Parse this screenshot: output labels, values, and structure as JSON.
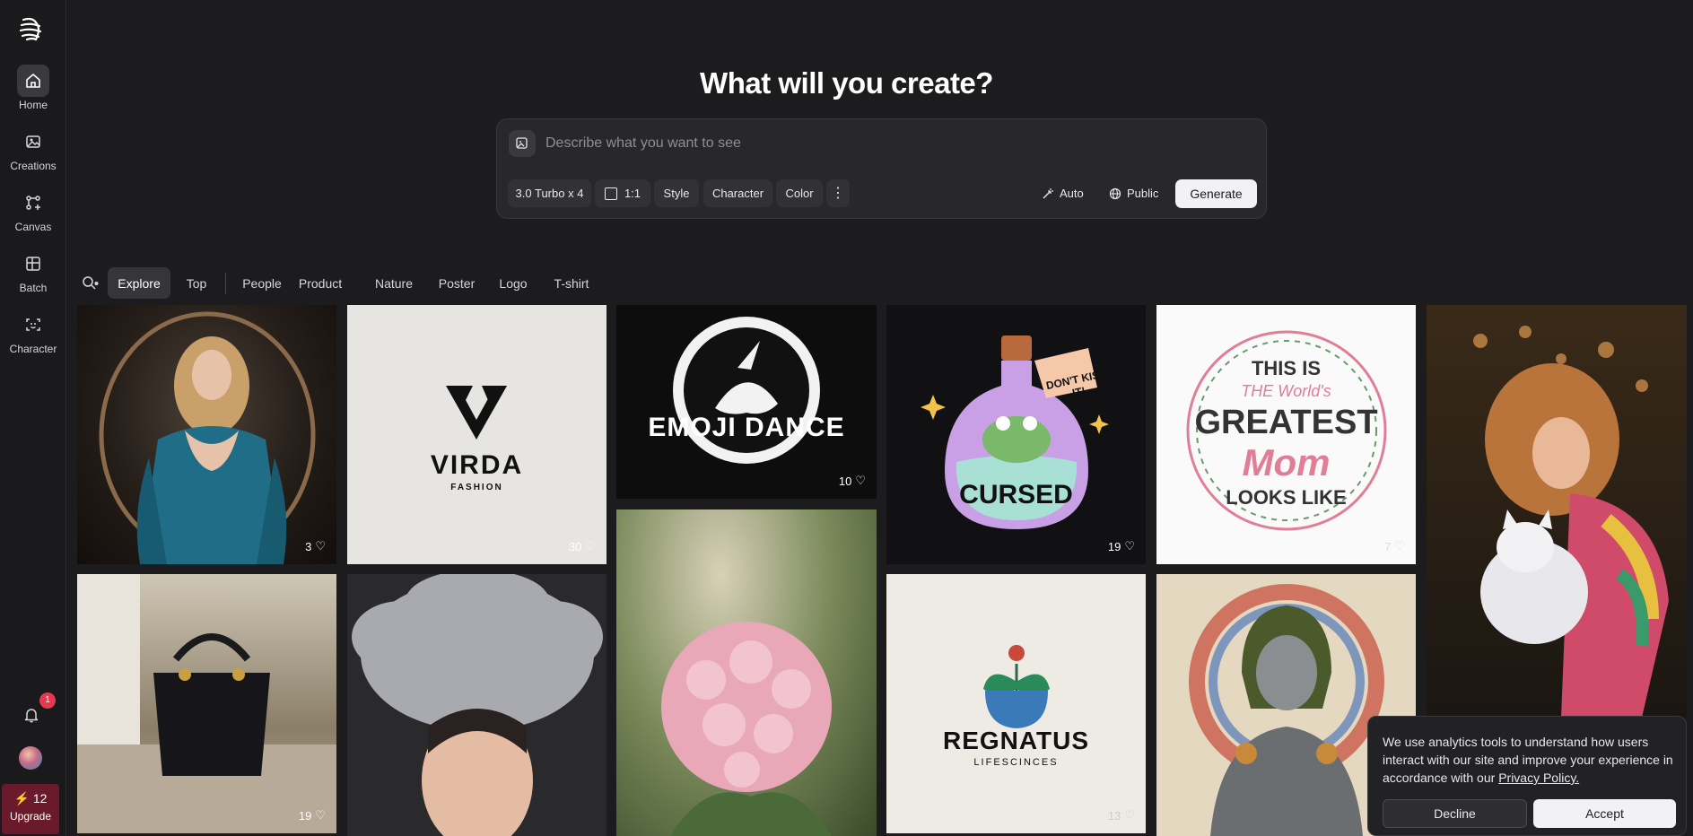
{
  "nav": {
    "items": [
      {
        "label": "Home",
        "icon": "home-icon"
      },
      {
        "label": "Creations",
        "icon": "image-icon"
      },
      {
        "label": "Canvas",
        "icon": "canvas-icon"
      },
      {
        "label": "Batch",
        "icon": "batch-icon"
      },
      {
        "label": "Character",
        "icon": "character-icon"
      }
    ],
    "notification_count": "1",
    "credits": "12",
    "upgrade_label": "Upgrade"
  },
  "hero": {
    "title": "What will you create?"
  },
  "prompt": {
    "placeholder": "Describe what you want to see",
    "model": "3.0 Turbo x 4",
    "ratio": "1:1",
    "style": "Style",
    "character": "Character",
    "color": "Color",
    "auto": "Auto",
    "visibility": "Public",
    "generate": "Generate"
  },
  "filters": [
    "Explore",
    "Top",
    "People",
    "Product",
    "Nature",
    "Poster",
    "Logo",
    "T-shirt"
  ],
  "gallery": [
    {
      "title": "Woman in blue gown",
      "likes": "3"
    },
    {
      "title": "VIRDA FASHION logo",
      "text1": "VIRDA",
      "text2": "FASHION",
      "likes": "30"
    },
    {
      "title": "EMOJI DANCE",
      "text1": "EMOJI DANCE",
      "likes": "10"
    },
    {
      "title": "CURSED frog",
      "text1": "DON'T KISS IT!",
      "text2": "CURSED",
      "likes": "19"
    },
    {
      "title": "Greatest Mom",
      "text1": "THIS IS",
      "text2": "THE World's",
      "text3": "GREATEST",
      "text4": "Mom",
      "text5": "LOOKS LIKE",
      "likes": "7"
    },
    {
      "title": "Girl with cat"
    },
    {
      "title": "Black handbag",
      "likes": "19"
    },
    {
      "title": "Feather headdress"
    },
    {
      "title": "Pink hydrangea"
    },
    {
      "title": "REGNATUS logo",
      "text1": "REGNATUS",
      "text2": "LIFESCINCES",
      "likes": "13"
    },
    {
      "title": "Armored villain"
    }
  ],
  "cookie": {
    "text": "We use analytics tools to understand how users interact with our site and improve your experience in accordance with our",
    "link": "Privacy Policy.",
    "decline": "Decline",
    "accept": "Accept"
  }
}
